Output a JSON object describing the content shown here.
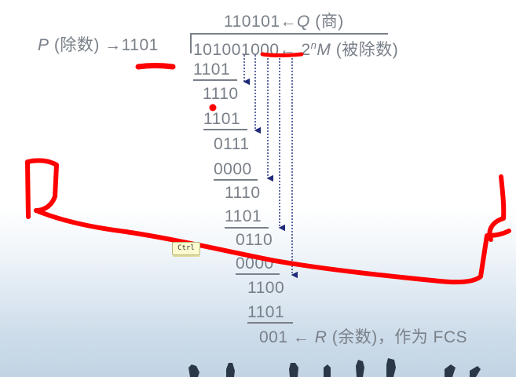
{
  "quotient": {
    "value": "110101",
    "arrow": "←",
    "symbol": "Q",
    "label": " (商)"
  },
  "divisor": {
    "symbol": "P",
    "label": " (除数) ",
    "arrow": "→",
    "value": "1101"
  },
  "dividend": {
    "value": "101001000",
    "arrow": "←",
    "expr_base": " 2",
    "expr_exp": "n",
    "expr_symbol": "M",
    "label": " (被除数)"
  },
  "steps": [
    "1101",
    "1110",
    "1101",
    "0111",
    "0000",
    "1110",
    "1101",
    "0110",
    "0000",
    "1100",
    "1101"
  ],
  "remainder": {
    "value": "001",
    "arrow": "←",
    "symbol": "R",
    "label": " (余数)，作为 FCS"
  },
  "ctrl_tooltip": "Ctrl",
  "colors": {
    "text": "#7a8089",
    "arrows": "#1e2a78",
    "ink": "#ff0000"
  }
}
